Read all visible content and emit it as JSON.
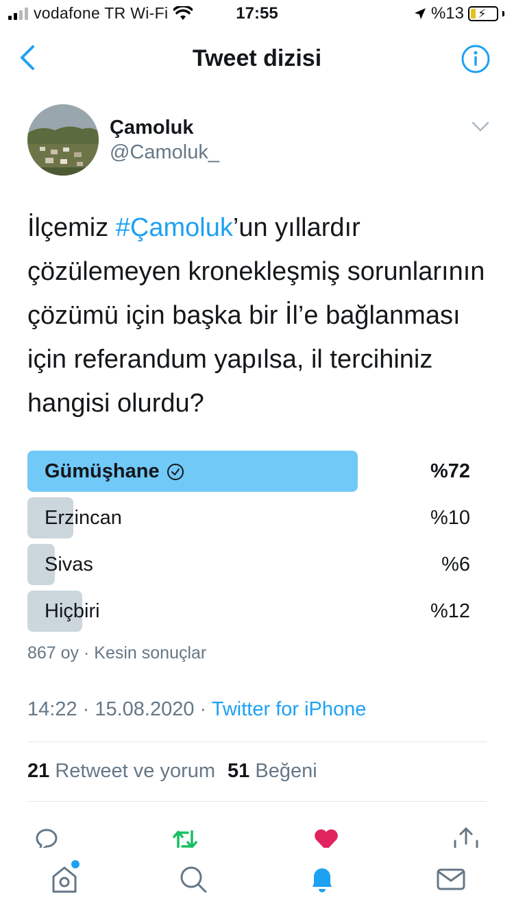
{
  "status_bar": {
    "carrier": "vodafone TR Wi-Fi",
    "time": "17:55",
    "battery": "%13"
  },
  "nav": {
    "title": "Tweet dizisi"
  },
  "tweet": {
    "display_name": "Çamoluk",
    "handle": "@Camoluk_",
    "text_before": "İlçemiz ",
    "hashtag": "#Çamoluk",
    "text_after": "’un yıllardır çözülemeyen kronekleşmiş sorunlarının çözümü için başka bir İl’e bağlanması için referandum yapılsa, il tercihiniz hangisi olurdu?",
    "poll": {
      "options": [
        {
          "label": "Gümüşhane",
          "percent_label": "%72",
          "percent": 72,
          "winner": true
        },
        {
          "label": "Erzincan",
          "percent_label": "%10",
          "percent": 10,
          "winner": false
        },
        {
          "label": "Sivas",
          "percent_label": "%6",
          "percent": 6,
          "winner": false
        },
        {
          "label": "Hiçbiri",
          "percent_label": "%12",
          "percent": 12,
          "winner": false
        }
      ],
      "meta": "867 oy · Kesin sonuçlar"
    },
    "time": "14:22 · 15.08.2020 · ",
    "source": "Twitter for iPhone",
    "stats": {
      "retweets_count": "21",
      "retweets_label": "Retweet ve yorum",
      "likes_count": "51",
      "likes_label": "Beğeni"
    }
  },
  "colors": {
    "accent": "#1da1f2",
    "winner_bar": "#71c9f8",
    "loser_bar": "#ccd6dd",
    "retweet_green": "#17bf63",
    "like_red": "#e0245e"
  },
  "icons": {
    "tabs": [
      "home-icon",
      "search-icon",
      "notifications-icon",
      "messages-icon"
    ],
    "actions": [
      "reply-icon",
      "retweet-icon",
      "like-icon",
      "share-icon"
    ]
  }
}
